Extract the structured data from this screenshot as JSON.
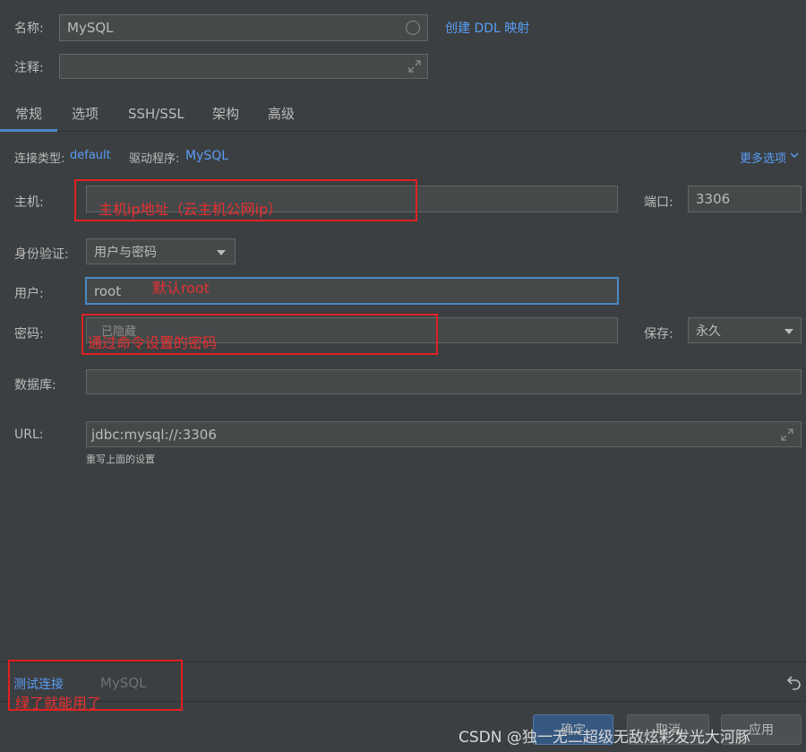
{
  "header": {
    "name_label": "名称:",
    "name_value": "MySQL",
    "ddl_link": "创建 DDL 映射",
    "comment_label": "注释:",
    "comment_value": ""
  },
  "tabs": [
    {
      "label": "常规",
      "active": true
    },
    {
      "label": "选项",
      "active": false
    },
    {
      "label": "SSH/SSL",
      "active": false
    },
    {
      "label": "架构",
      "active": false
    },
    {
      "label": "高级",
      "active": false
    }
  ],
  "conn": {
    "type_label": "连接类型:",
    "type_value": "default",
    "driver_label": "驱动程序:",
    "driver_value": "MySQL",
    "more_options": "更多选项"
  },
  "form": {
    "host_label": "主机:",
    "host_value": "",
    "port_label": "端口:",
    "port_value": "3306",
    "auth_label": "身份验证:",
    "auth_value": "用户与密码",
    "user_label": "用户:",
    "user_value": "root",
    "password_label": "密码:",
    "password_placeholder": "已隐藏",
    "save_label": "保存:",
    "save_value": "永久",
    "database_label": "数据库:",
    "database_value": "",
    "url_label": "URL:",
    "url_value": "jdbc:mysql://:3306",
    "url_hint": "重写上面的设置"
  },
  "footer": {
    "test_connection": "测试连接",
    "driver_name": "MySQL",
    "ok": "确定",
    "cancel": "取消",
    "apply": "应用"
  },
  "annotations": {
    "host_note": "主机ip地址（云主机公网ip）",
    "user_note": "默认root",
    "password_note": "通过命令设置的密码",
    "test_note": "绿了就能用了"
  },
  "watermark": "CSDN @独一无二超级无敌炫彩发光大河豚",
  "colors": {
    "background": "#3c3f41",
    "field": "#45494a",
    "link": "#589df6",
    "focus": "#4a88c7",
    "annotation": "#e02020"
  }
}
